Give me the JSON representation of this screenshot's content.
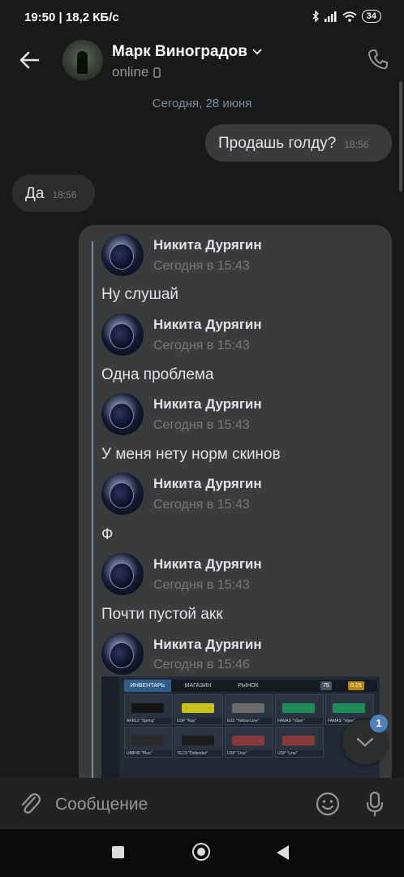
{
  "status_bar": {
    "time_speed": "19:50 | 18,2 КБ/с",
    "battery": "34"
  },
  "header": {
    "name": "Марк Виноградов",
    "status": "online"
  },
  "chat": {
    "date_separator": "Сегодня, 28 июня",
    "messages": [
      {
        "direction": "out",
        "text": "Продашь голду?",
        "time": "18:56"
      },
      {
        "direction": "in",
        "text": "Да",
        "time": "18:56"
      }
    ],
    "forwarded": [
      {
        "author": "Никита Дурягин",
        "time": "Сегодня в 15:43",
        "text": "Ну слушай"
      },
      {
        "author": "Никита Дурягин",
        "time": "Сегодня в 15:43",
        "text": "Одна проблема"
      },
      {
        "author": "Никита Дурягин",
        "time": "Сегодня в 15:43",
        "text": "У меня нету норм скинов"
      },
      {
        "author": "Никита Дурягин",
        "time": "Сегодня в 15:43",
        "text": "Ф"
      },
      {
        "author": "Никита Дурягин",
        "time": "Сегодня в 15:43",
        "text": "Почти пустой акк"
      },
      {
        "author": "Никита Дурягин",
        "time": "Сегодня в 15:46",
        "text": ""
      }
    ],
    "screenshot": {
      "tabs": [
        "ИНВЕНТАРЬ",
        "МАГАЗИН",
        "РЫНОК"
      ],
      "currency_silver": "75",
      "currency_gold": "0.15",
      "items": [
        "AKR12 \"Spring\"",
        "USP \"Ray\"",
        "G22 \"Yellow Line\"",
        "FAMAS \"Viper\"",
        "FAMAS \"Viper\"",
        "UMP45 \"Plus\"",
        "TEC9 \"Defender\"",
        "USP \"Line\"",
        "USP \"Line\""
      ]
    },
    "unread_count": "1"
  },
  "composer": {
    "placeholder": "Сообщение"
  },
  "colors": {
    "background": "#19191a",
    "bubble_out": "#3a3b3c",
    "bubble_in": "#2c2d2e",
    "accent": "#5181b8"
  }
}
